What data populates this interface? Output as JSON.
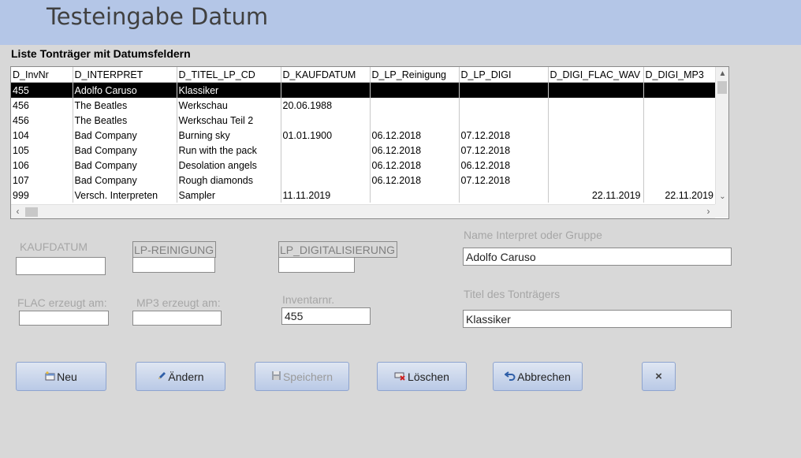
{
  "header": {
    "title": "Testeingabe Datum"
  },
  "list": {
    "caption": "Liste Tonträger  mit Datumsfeldern",
    "columns": [
      "D_InvNr",
      "D_INTERPRET",
      "D_TITEL_LP_CD",
      "D_KAUFDATUM",
      "D_LP_Reinigung",
      "D_LP_DIGI",
      "D_DIGI_FLAC_WAV",
      "D_DIGI_MP3"
    ],
    "rows": [
      [
        "455",
        "Adolfo Caruso",
        "Klassiker",
        "",
        "",
        "",
        "",
        ""
      ],
      [
        "456",
        "The Beatles",
        "Werkschau",
        "20.06.1988",
        "",
        "",
        "",
        ""
      ],
      [
        "456",
        "The Beatles",
        "Werkschau Teil 2",
        "",
        "",
        "",
        "",
        ""
      ],
      [
        "104",
        "Bad Company",
        "Burning sky",
        "01.01.1900",
        "06.12.2018",
        "07.12.2018",
        "",
        ""
      ],
      [
        "105",
        "Bad Company",
        "Run with the pack",
        "",
        "06.12.2018",
        "07.12.2018",
        "",
        ""
      ],
      [
        "106",
        "Bad Company",
        "Desolation angels",
        "",
        "06.12.2018",
        "06.12.2018",
        "",
        ""
      ],
      [
        "107",
        "Bad Company",
        "Rough diamonds",
        "",
        "06.12.2018",
        "07.12.2018",
        "",
        ""
      ],
      [
        "999",
        "Versch. Interpreten",
        "Sampler",
        "11.11.2019",
        "",
        "",
        "22.11.2019",
        "22.11.2019"
      ]
    ],
    "selected_row": 0
  },
  "form": {
    "kaufdatum_label": "KAUFDATUM",
    "kaufdatum_value": "",
    "lp_reinigung_label": "LP-REINIGUNG",
    "lp_reinigung_value": "",
    "lp_digitalisierung_label": "LP_DIGITALISIERUNG",
    "lp_digitalisierung_value": "",
    "interpret_label": "Name Interpret oder Gruppe",
    "interpret_value": "Adolfo Caruso",
    "flac_label": "FLAC erzeugt am:",
    "flac_value": "",
    "mp3_label": "MP3 erzeugt am:",
    "mp3_value": "",
    "inventarnr_label": "Inventarnr.",
    "inventarnr_value": "455",
    "titel_label": "Titel des Tonträgers",
    "titel_value": "Klassiker"
  },
  "buttons": {
    "neu": "Neu",
    "aendern": "Ändern",
    "speichern": "Speichern",
    "loeschen": "Löschen",
    "abbrechen": "Abbrechen",
    "close": "×"
  },
  "icons": {
    "neu": "new-record-icon",
    "aendern": "pencil-icon",
    "speichern": "save-icon",
    "loeschen": "delete-icon",
    "abbrechen": "undo-icon",
    "close": "close-icon"
  },
  "colors": {
    "header_bg": "#b4c6e7",
    "body_bg": "#d8d8d8",
    "selected_row_bg": "#000000",
    "button_bg": "#c7d4ec"
  }
}
